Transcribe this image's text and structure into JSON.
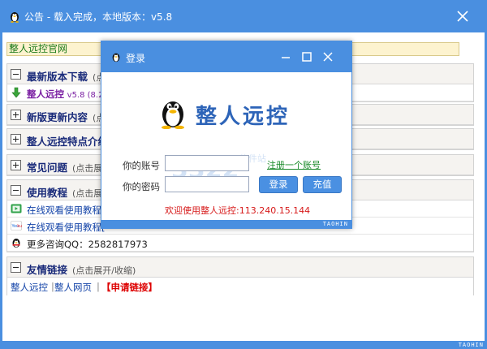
{
  "outer_window": {
    "title": "公告 - 载入完成，本地版本：v5.8",
    "brand": "TAOHIN"
  },
  "notice": {
    "official_link": "整人远控官网",
    "sections": [
      {
        "title": "最新版本下载",
        "hint": "(点",
        "collapsed": false
      },
      {
        "title": "新版更新内容",
        "hint": "(点",
        "collapsed": true
      },
      {
        "title": "整人远控特点介绍",
        "hint": "",
        "collapsed": true
      },
      {
        "title": "常见问题",
        "hint": "(点击展开",
        "collapsed": true
      },
      {
        "title": "使用教程",
        "hint": "(点击展",
        "collapsed": false
      },
      {
        "title": "友情链接",
        "hint": "(点击展开/收缩)",
        "collapsed": false
      }
    ],
    "download_row": {
      "name": "整人远控",
      "version": "v5.8 (8.2"
    },
    "tutorials": [
      {
        "text": "在线观看使用教程[",
        "icon": "video-icon"
      },
      {
        "text": "在线观看使用教程[",
        "icon": "youku-icon"
      }
    ],
    "qq_row": {
      "text": "更多咨询QQ：2582817973",
      "icon": "qq-icon"
    },
    "friend_links": {
      "link1": "整人远控",
      "sep1": "|",
      "link2": "整人网页",
      "sep2": "|",
      "apply": "【申请链接】"
    }
  },
  "login": {
    "title": "登录",
    "logo_text": "整人远控",
    "account_label": "你的账号",
    "password_label": "你的密码",
    "account_value": "",
    "password_value": "",
    "register_link": "注册一个账号",
    "login_button": "登录",
    "recharge_button": "充值",
    "welcome": "欢迎使用整人远控:113.240.15.144",
    "brand": "TAOHIN",
    "watermark_text": "软件站",
    "watermark_number": "3322"
  },
  "colors": {
    "titlebar": "#4a8fe0",
    "section_title": "#1a2b7a",
    "welcome": "#d71a1a",
    "register": "#1a8a2a"
  }
}
